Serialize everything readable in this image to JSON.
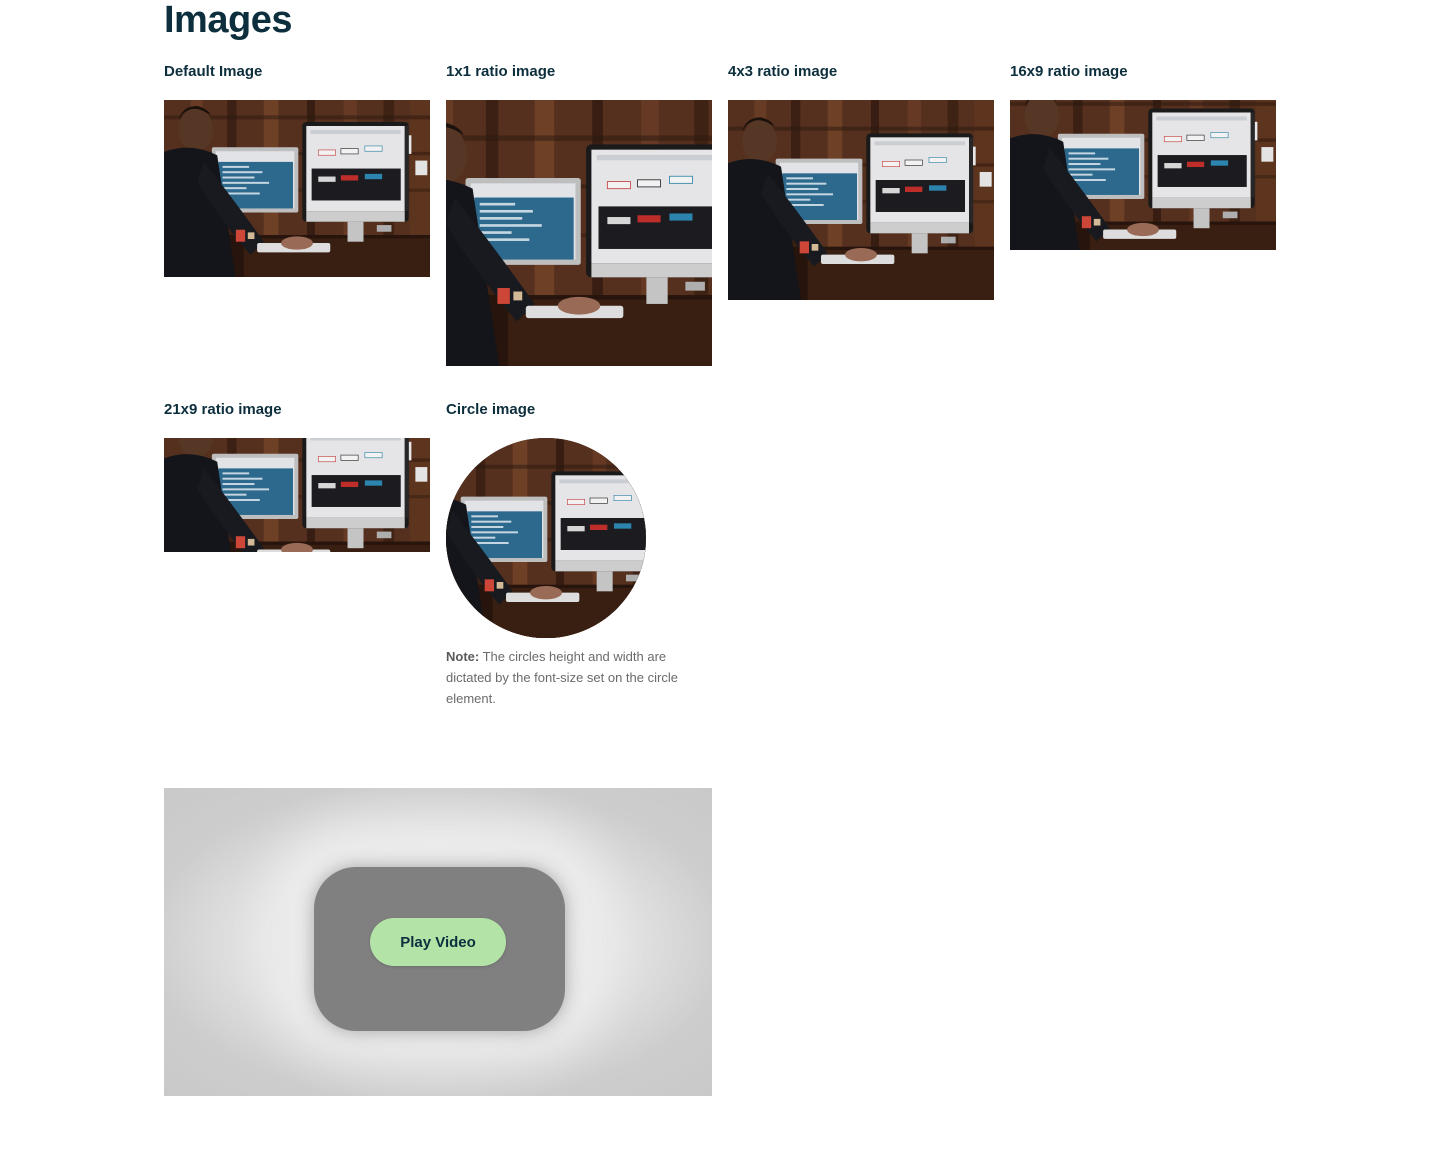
{
  "page": {
    "title": "Images"
  },
  "cards": [
    {
      "title": "Default Image"
    },
    {
      "title": "1x1 ratio image"
    },
    {
      "title": "4x3 ratio image"
    },
    {
      "title": "16x9 ratio image"
    },
    {
      "title": "21x9 ratio image"
    },
    {
      "title": "Circle image"
    }
  ],
  "note": {
    "label": "Note:",
    "text": " The circles height and width are dictated by the font-size set on the circle element."
  },
  "video": {
    "button_label": "Play Video"
  },
  "colors": {
    "heading": "#0d2f3d",
    "play_button": "#b4e3a8",
    "video_shape": "#808080",
    "note_text": "#6b6b6b"
  }
}
